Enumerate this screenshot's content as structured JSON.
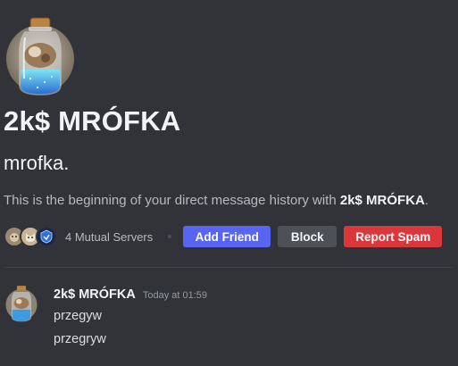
{
  "profile": {
    "display_name": "2k$ MRÓFKA",
    "username": "mrofka."
  },
  "intro": {
    "prefix": "This is the beginning of your direct message history with ",
    "name": "2k$ MRÓFKA",
    "suffix": "."
  },
  "mutual": {
    "label": "4 Mutual Servers",
    "icons": [
      "server-icon-dog",
      "server-icon-cat",
      "server-icon-shield"
    ]
  },
  "buttons": {
    "add_friend": "Add Friend",
    "block": "Block",
    "report_spam": "Report Spam"
  },
  "message": {
    "author": "2k$ MRÓFKA",
    "timestamp": "Today at 01:59",
    "lines": [
      "przegyw",
      "przegryw"
    ]
  },
  "colors": {
    "background": "#313338",
    "blurple": "#5865f2",
    "secondary": "#4e5058",
    "danger": "#da373c"
  }
}
